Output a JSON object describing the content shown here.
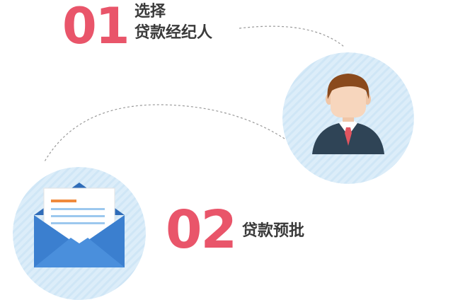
{
  "colors": {
    "accent": "#e9556a",
    "circle_bg": "#dcedf9",
    "stripe": "#c9e3f5",
    "envelope": "#3b7fcf",
    "suit": "#2f4456",
    "hair": "#8a4a1d",
    "skin": "#f7d6bd",
    "tie": "#e25560"
  },
  "steps": [
    {
      "number": "01",
      "label_line1": "选择",
      "label_line2": "贷款经纪人",
      "icon": "agent-icon"
    },
    {
      "number": "02",
      "label": "贷款预批",
      "icon": "envelope-letter-icon"
    }
  ]
}
